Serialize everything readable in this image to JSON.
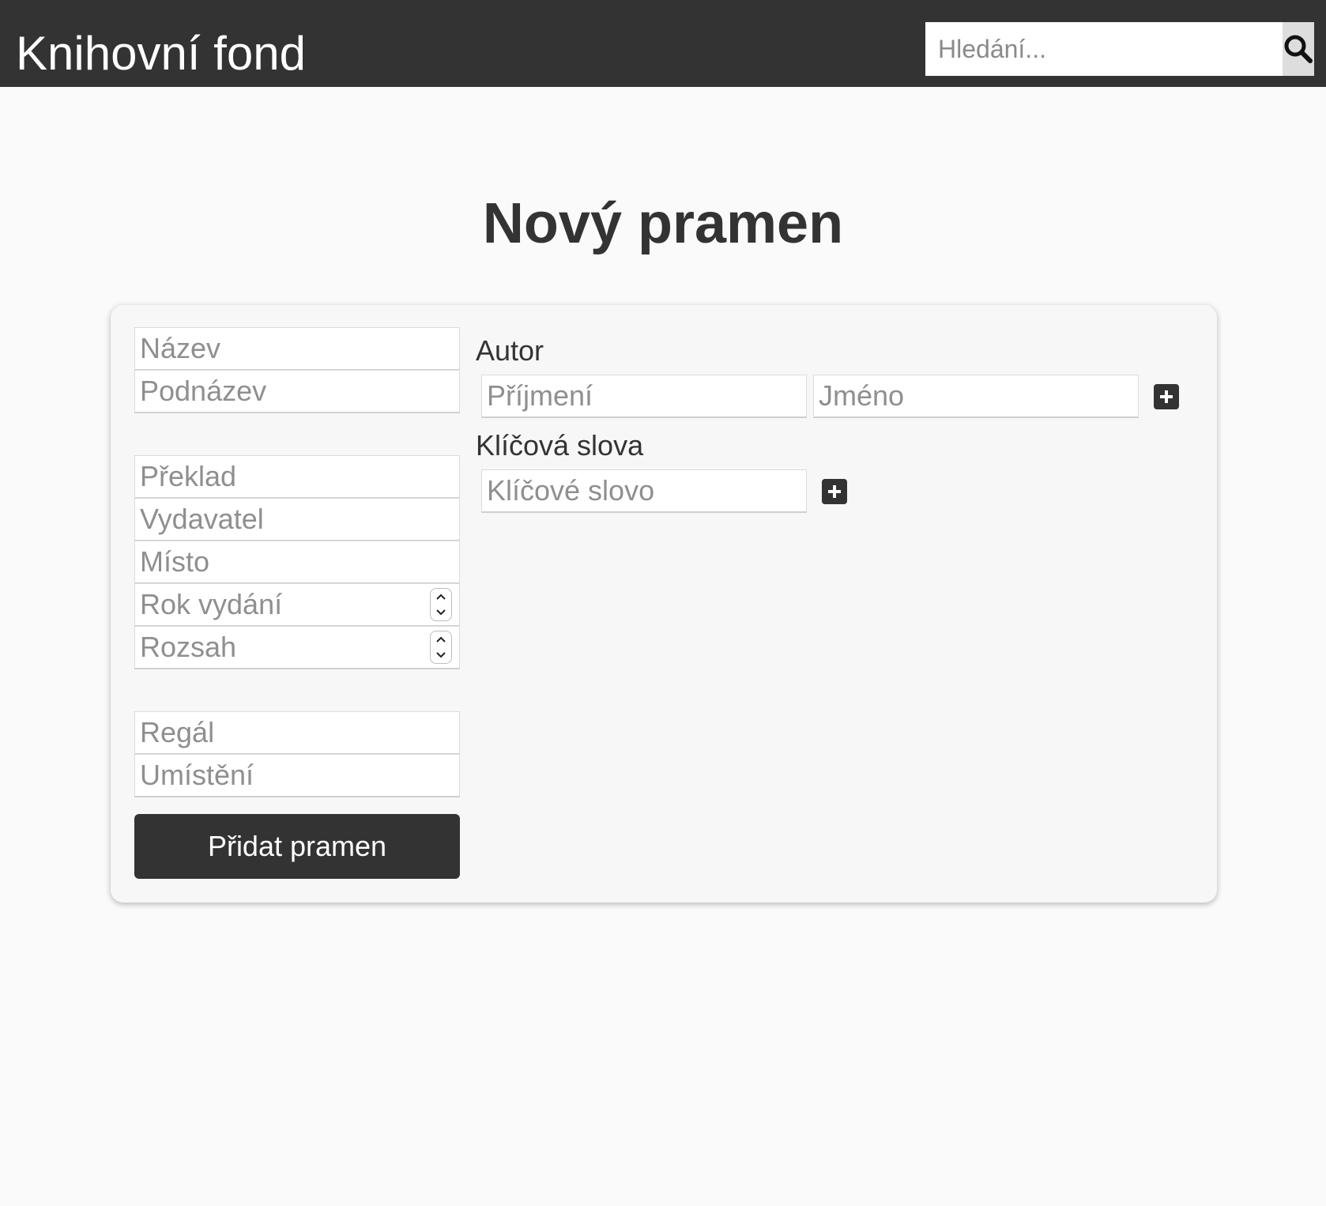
{
  "header": {
    "brand": "Knihovní fond",
    "search_placeholder": "Hledání..."
  },
  "page": {
    "title": "Nový pramen"
  },
  "form": {
    "title_placeholder": "Název",
    "subtitle_placeholder": "Podnázev",
    "translation_placeholder": "Překlad",
    "publisher_placeholder": "Vydavatel",
    "place_placeholder": "Místo",
    "year_placeholder": "Rok vydání",
    "extent_placeholder": "Rozsah",
    "shelf_placeholder": "Regál",
    "location_placeholder": "Umístění",
    "submit_label": "Přidat pramen",
    "author": {
      "label": "Autor",
      "surname_placeholder": "Příjmení",
      "firstname_placeholder": "Jméno"
    },
    "keywords": {
      "label": "Klíčová slova",
      "keyword_placeholder": "Klíčové slovo"
    }
  },
  "colors": {
    "header_bg": "#333333",
    "page_bg": "#fafafa",
    "card_bg": "#f7f7f7",
    "button_bg": "#333333",
    "search_button_bg": "#dddddd"
  },
  "icons": {
    "search": "search-icon",
    "add_author": "plus-icon",
    "add_keyword": "plus-icon",
    "spinner_up": "chevron-up-icon",
    "spinner_down": "chevron-down-icon"
  }
}
